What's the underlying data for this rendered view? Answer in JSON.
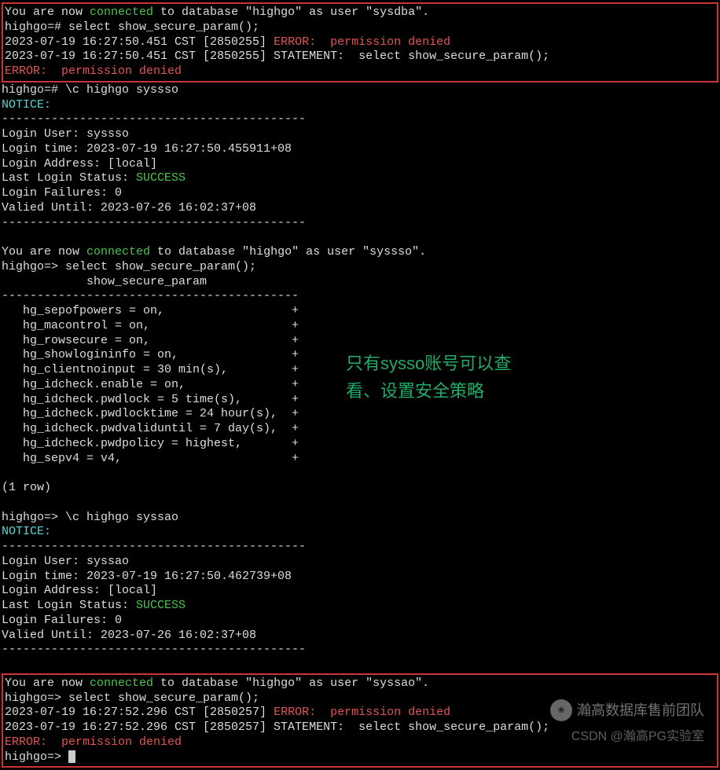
{
  "box1": {
    "l1_pre": "You are now ",
    "l1_connected": "connected",
    "l1_post": " to database \"highgo\" as user \"sysdba\".",
    "l2": "highgo=# select show_secure_param();",
    "l3_pre": "2023-07-19 16:27:50.451 CST [2850255] ",
    "l3_err": "ERROR:  permission denied",
    "l4": "2023-07-19 16:27:50.451 CST [2850255] STATEMENT:  select show_secure_param();",
    "l5": "ERROR:  permission denied"
  },
  "mid1": {
    "l1": "highgo=# \\c highgo syssso",
    "notice": "NOTICE:",
    "sep": "-------------------------------------------",
    "login_user": "Login User: syssso",
    "login_time": "Login time: 2023-07-19 16:27:50.455911+08",
    "login_addr": "Login Address: [local]",
    "last_status_pre": "Last Login Status: ",
    "last_status_val": "SUCCESS",
    "login_fail": "Login Failures: 0",
    "valid_until": "Valied Until: 2023-07-26 16:02:37+08"
  },
  "block2": {
    "l1_pre": "You are now ",
    "l1_connected": "connected",
    "l1_post": " to database \"highgo\" as user \"syssso\".",
    "l2": "highgo=> select show_secure_param();",
    "hdr": "            show_secure_param",
    "sep2": "------------------------------------------",
    "r1": "   hg_sepofpowers = on,                  +",
    "r2": "   hg_macontrol = on,                    +",
    "r3": "   hg_rowsecure = on,                    +",
    "r4": "   hg_showlogininfo = on,                +",
    "r5": "   hg_clientnoinput = 30 min(s),         +",
    "r6": "   hg_idcheck.enable = on,               +",
    "r7": "   hg_idcheck.pwdlock = 5 time(s),       +",
    "r8": "   hg_idcheck.pwdlocktime = 24 hour(s),  +",
    "r9": "   hg_idcheck.pwdvaliduntil = 7 day(s),  +",
    "r10": "   hg_idcheck.pwdpolicy = highest,       +",
    "r11": "   hg_sepv4 = v4,                        +",
    "blank": " ",
    "count": "(1 row)"
  },
  "mid2": {
    "l1": "highgo=> \\c highgo syssao",
    "notice": "NOTICE:",
    "sep": "-------------------------------------------",
    "login_user": "Login User: syssao",
    "login_time": "Login time: 2023-07-19 16:27:50.462739+08",
    "login_addr": "Login Address: [local]",
    "last_status_pre": "Last Login Status: ",
    "last_status_val": "SUCCESS",
    "login_fail": "Login Failures: 0",
    "valid_until": "Valied Until: 2023-07-26 16:02:37+08"
  },
  "box2": {
    "l1_pre": "You are now ",
    "l1_connected": "connected",
    "l1_post": " to database \"highgo\" as user \"syssao\".",
    "l2": "highgo=> select show_secure_param();",
    "l3_pre": "2023-07-19 16:27:52.296 CST [2850257] ",
    "l3_err": "ERROR:  permission denied",
    "l4": "2023-07-19 16:27:52.296 CST [2850257] STATEMENT:  select show_secure_param();",
    "l5": "ERROR:  permission denied",
    "l6": "highgo=> "
  },
  "annotation": {
    "l1": "只有sysso账号可以查",
    "l2": "看、设置安全策略"
  },
  "watermark": {
    "logo_text": "瀚高数据库售前团队",
    "csdn": "CSDN @瀚高PG实验室"
  }
}
